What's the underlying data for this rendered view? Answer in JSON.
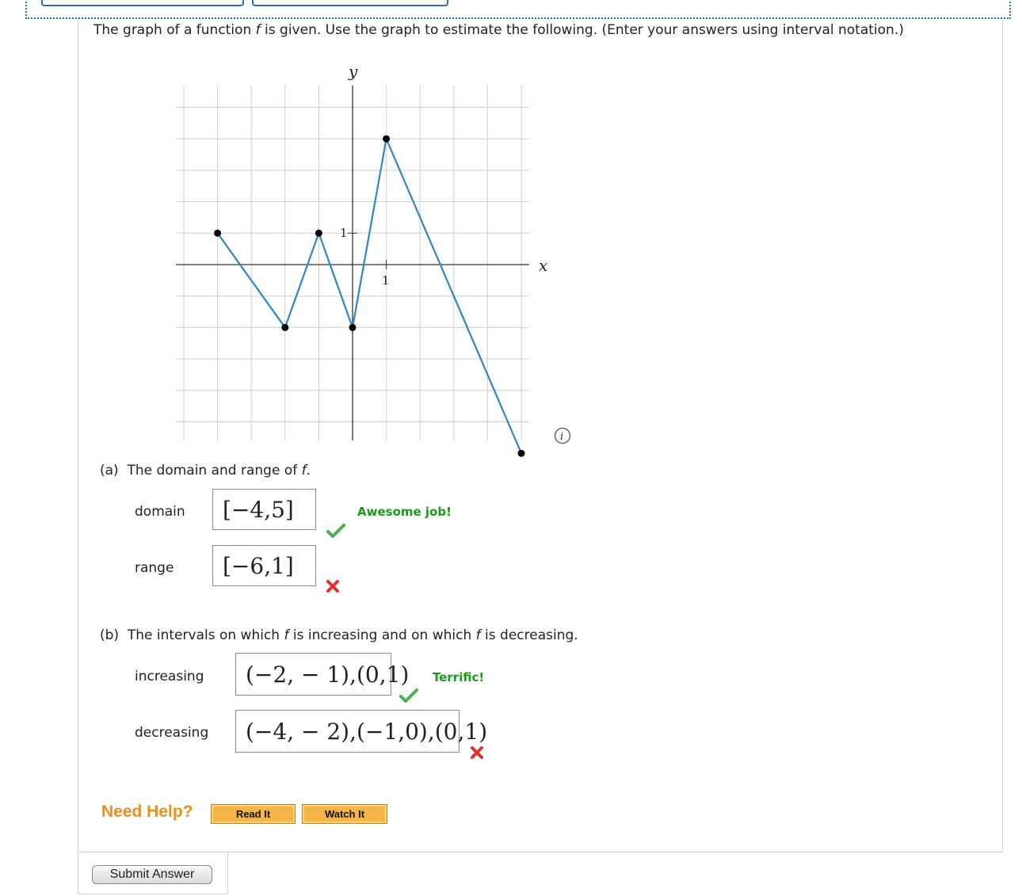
{
  "question": {
    "text_before_f": "The graph of a function ",
    "f": "f",
    "text_after_f": " is given. Use the graph to estimate the following. (Enter your answers using interval notation.)"
  },
  "graph": {
    "y_label": "y",
    "x_label": "x",
    "x_tick_label": "1",
    "y_tick_label": "1",
    "line_color": "#2e86c8",
    "points": [
      [
        -4,
        1
      ],
      [
        -2,
        -2
      ],
      [
        -1,
        1
      ],
      [
        0,
        -2
      ],
      [
        1,
        4
      ],
      [
        5,
        -6
      ]
    ],
    "x_range": [
      -5,
      5
    ],
    "y_range": [
      -6,
      5
    ]
  },
  "part_a": {
    "label": "(a)",
    "text": "The domain and range of ",
    "f": "f",
    "period": ".",
    "domain_label": "domain",
    "domain_value": "[−4,5]",
    "domain_feedback": "Awesome job!",
    "range_label": "range",
    "range_value": "[−6,1]"
  },
  "part_b": {
    "label": "(b)",
    "text1": "The intervals on which ",
    "f1": "f",
    "text2": " is increasing and on which ",
    "f2": "f",
    "text3": " is decreasing.",
    "increasing_label": "increasing",
    "increasing_value": "(−2, − 1),(0,1)",
    "increasing_feedback": "Terrific!",
    "decreasing_label": "decreasing",
    "decreasing_value": "(−4, − 2),(−1,0),(0,1)"
  },
  "help": {
    "title": "Need Help?",
    "read_it": "Read It",
    "watch_it": "Watch It"
  },
  "submit_label": "Submit Answer",
  "colors": {
    "success": "#1a9a1a",
    "error": "#e03030",
    "help_orange": "#f08c1a"
  }
}
